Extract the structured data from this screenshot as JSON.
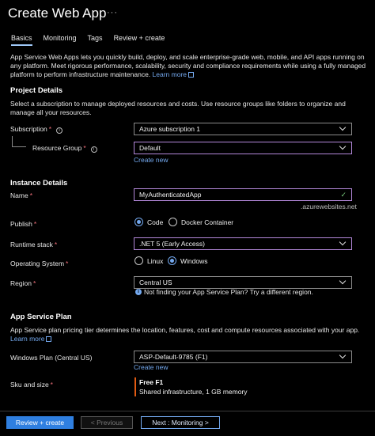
{
  "header": {
    "title": "Create Web App",
    "more": "···"
  },
  "tabs": [
    {
      "label": "Basics"
    },
    {
      "label": "Monitoring"
    },
    {
      "label": "Tags"
    },
    {
      "label": "Review + create"
    }
  ],
  "intro": {
    "text": "App Service Web Apps lets you quickly build, deploy, and scale enterprise-grade web, mobile, and API apps running on any platform. Meet rigorous performance, scalability, security and compliance requirements while using a fully managed platform to perform infrastructure maintenance.",
    "link": "Learn more"
  },
  "project": {
    "heading": "Project Details",
    "text": "Select a subscription to manage deployed resources and costs. Use resource groups like folders to organize and manage all your resources.",
    "subscription_label": "Subscription",
    "subscription_value": "Azure subscription 1",
    "rg_label": "Resource Group",
    "rg_value": "Default",
    "create_new": "Create new"
  },
  "instance": {
    "heading": "Instance Details",
    "name_label": "Name",
    "name_value": "MyAuthenticatedApp",
    "name_suffix": ".azurewebsites.net",
    "publish_label": "Publish",
    "publish_opt1": "Code",
    "publish_opt2": "Docker Container",
    "runtime_label": "Runtime stack",
    "runtime_value": ".NET 5 (Early Access)",
    "os_label": "Operating System",
    "os_opt1": "Linux",
    "os_opt2": "Windows",
    "region_label": "Region",
    "region_value": "Central US",
    "region_notice": "Not finding your App Service Plan? Try a different region."
  },
  "plan": {
    "heading": "App Service Plan",
    "text": "App Service plan pricing tier determines the location, features, cost and compute resources associated with your app.",
    "link": "Learn more",
    "windows_plan_label": "Windows Plan (Central US)",
    "windows_plan_value": "ASP-Default-9785 (F1)",
    "create_new": "Create new",
    "sku_label": "Sku and size",
    "sku_name": "Free F1",
    "sku_desc": "Shared infrastructure, 1 GB memory"
  },
  "footer": {
    "review": "Review + create",
    "previous": "< Previous",
    "next": "Next : Monitoring >"
  },
  "colors": {
    "accent": "#2f7fe0",
    "link": "#74a9ef",
    "required": "#f1707b",
    "sku_bar": "#e25b12"
  }
}
